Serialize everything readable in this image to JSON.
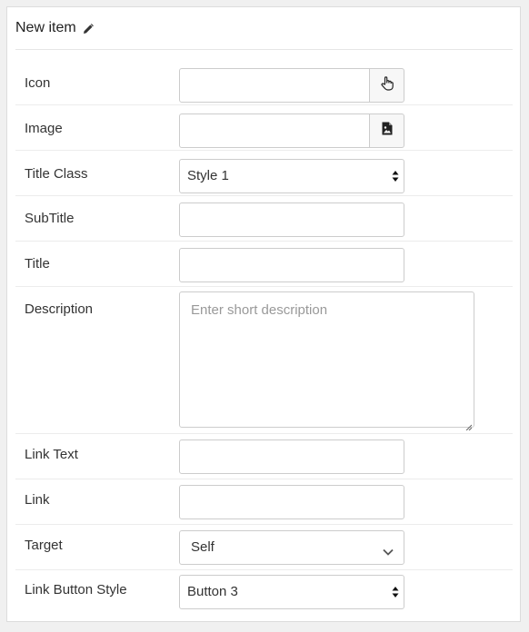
{
  "header": {
    "title": "New item",
    "edit_icon": "pencil-icon"
  },
  "form": {
    "icon": {
      "label": "Icon",
      "value": "",
      "button_icon": "hand-pointer-icon"
    },
    "image": {
      "label": "Image",
      "value": "",
      "button_icon": "image-file-icon"
    },
    "title_class": {
      "label": "Title Class",
      "selected": "Style 1"
    },
    "subtitle": {
      "label": "SubTitle",
      "value": ""
    },
    "title": {
      "label": "Title",
      "value": ""
    },
    "description": {
      "label": "Description",
      "placeholder": "Enter short description",
      "value": ""
    },
    "link_text": {
      "label": "Link Text",
      "value": ""
    },
    "link": {
      "label": "Link",
      "value": ""
    },
    "target": {
      "label": "Target",
      "selected": "Self"
    },
    "link_button_style": {
      "label": "Link Button Style",
      "selected": "Button 3"
    }
  }
}
